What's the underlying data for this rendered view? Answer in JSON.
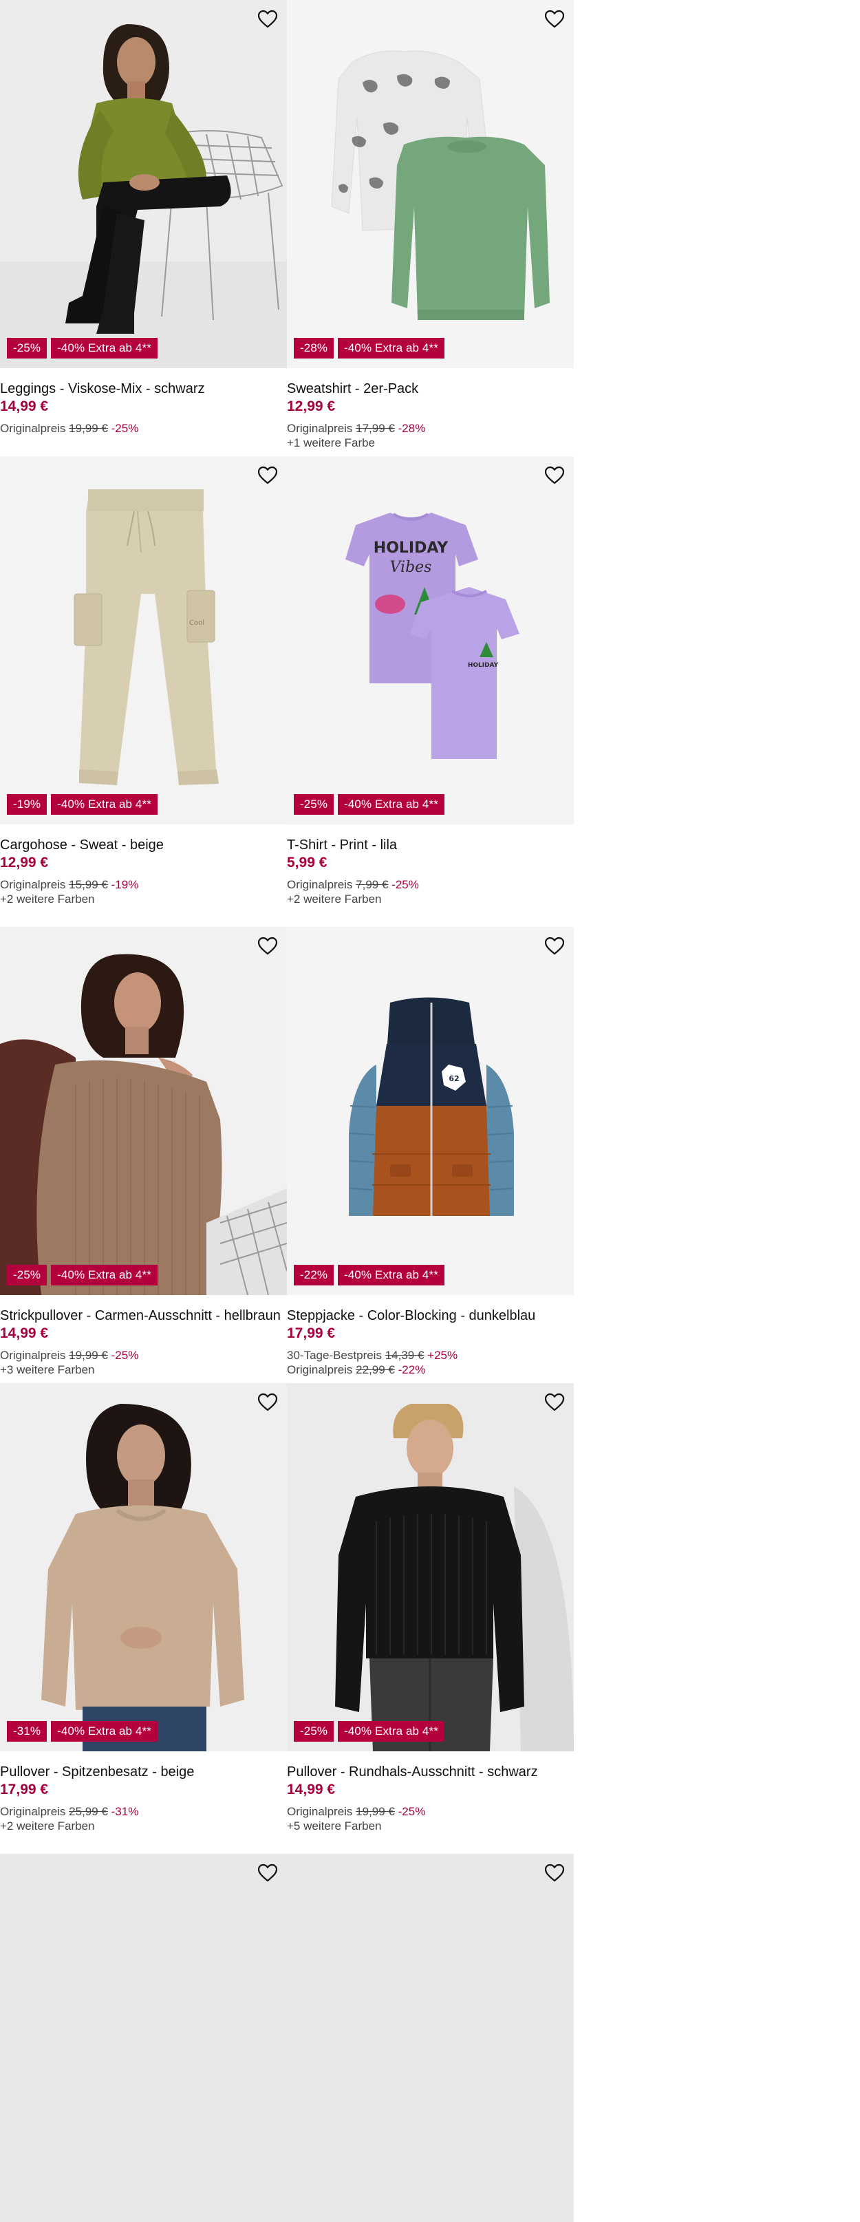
{
  "products": [
    {
      "name": "Leggings - Viskose-Mix - schwarz",
      "price": "14,99 €",
      "badges": [
        "-25%",
        "-40% Extra ab 4**"
      ],
      "reference_lines": [
        {
          "label": "Originalpreis",
          "old_price": "19,99 €",
          "discount": "-25%"
        }
      ],
      "colors_note": "",
      "image": "woman-green-top-chair",
      "favorite_icon": "heart-outline-icon"
    },
    {
      "name": "Sweatshirt - 2er-Pack",
      "price": "12,99 €",
      "badges": [
        "-28%",
        "-40% Extra ab 4**"
      ],
      "reference_lines": [
        {
          "label": "Originalpreis",
          "old_price": "17,99 €",
          "discount": "-28%"
        }
      ],
      "colors_note": "+1 weitere Farbe",
      "image": "sweatshirts-grey-green",
      "favorite_icon": "heart-outline-icon"
    },
    {
      "name": "Cargohose - Sweat - beige",
      "price": "12,99 €",
      "badges": [
        "-19%",
        "-40% Extra ab 4**"
      ],
      "reference_lines": [
        {
          "label": "Originalpreis",
          "old_price": "15,99 €",
          "discount": "-19%"
        }
      ],
      "colors_note": "+2 weitere Farben",
      "image": "beige-cargo-pants",
      "favorite_icon": "heart-outline-icon"
    },
    {
      "name": "T-Shirt - Print - lila",
      "price": "5,99 €",
      "badges": [
        "-25%",
        "-40% Extra ab 4**"
      ],
      "reference_lines": [
        {
          "label": "Originalpreis",
          "old_price": "7,99 €",
          "discount": "-25%"
        }
      ],
      "colors_note": "+2 weitere Farben",
      "image": "lilac-tshirts",
      "print_text": {
        "line1": "HOLIDAY",
        "line2": "Vibes"
      },
      "favorite_icon": "heart-outline-icon"
    },
    {
      "name": "Strickpullover - Carmen-Ausschnitt - hellbraun",
      "price": "14,99 €",
      "badges": [
        "-25%",
        "-40% Extra ab 4**"
      ],
      "reference_lines": [
        {
          "label": "Originalpreis",
          "old_price": "19,99 €",
          "discount": "-25%"
        }
      ],
      "colors_note": "+3 weitere Farben",
      "image": "woman-offshoulder-knit",
      "favorite_icon": "heart-outline-icon"
    },
    {
      "name": "Steppjacke - Color-Blocking - dunkelblau",
      "price": "17,99 €",
      "badges": [
        "-22%",
        "-40% Extra ab 4**"
      ],
      "reference_lines": [
        {
          "label": "30-Tage-Bestpreis",
          "old_price": "14,39 €",
          "discount": "+25%"
        },
        {
          "label": "Originalpreis",
          "old_price": "22,99 €",
          "discount": "-22%"
        }
      ],
      "colors_note": "",
      "image": "colorblock-puffer-jacket",
      "favorite_icon": "heart-outline-icon"
    },
    {
      "name": "Pullover - Spitzenbesatz - beige",
      "price": "17,99 €",
      "badges": [
        "-31%",
        "-40% Extra ab 4**"
      ],
      "reference_lines": [
        {
          "label": "Originalpreis",
          "old_price": "25,99 €",
          "discount": "-31%"
        }
      ],
      "colors_note": "+2 weitere Farben",
      "image": "woman-beige-sweater",
      "favorite_icon": "heart-outline-icon"
    },
    {
      "name": "Pullover - Rundhals-Ausschnitt - schwarz",
      "price": "14,99 €",
      "badges": [
        "-25%",
        "-40% Extra ab 4**"
      ],
      "reference_lines": [
        {
          "label": "Originalpreis",
          "old_price": "19,99 €",
          "discount": "-25%"
        }
      ],
      "colors_note": "+5 weitere Farben",
      "image": "man-black-sweater",
      "favorite_icon": "heart-outline-icon"
    },
    {
      "name": "",
      "price": "",
      "badges": [],
      "reference_lines": [],
      "colors_note": "",
      "image": "partial-next-row",
      "favorite_icon": "heart-outline-icon"
    },
    {
      "name": "",
      "price": "",
      "badges": [],
      "reference_lines": [],
      "colors_note": "",
      "image": "partial-next-row",
      "favorite_icon": "heart-outline-icon"
    }
  ],
  "colors": {
    "brand": "#b4003c",
    "price": "#a6003f",
    "image_bg": "#f2f2f2"
  }
}
